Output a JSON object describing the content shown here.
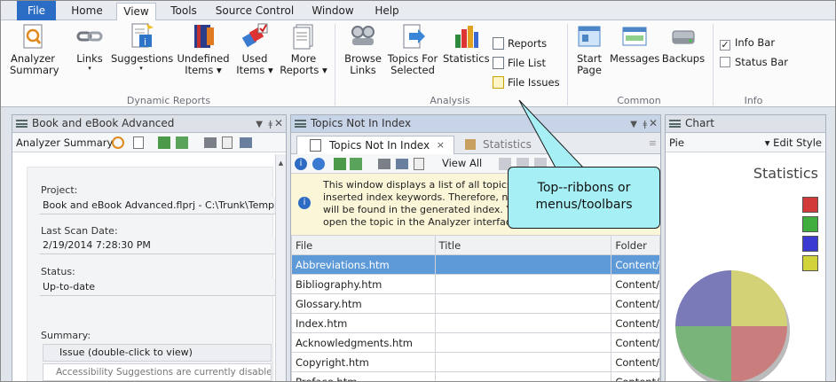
{
  "ribbon_tabs": [
    "File",
    "Home",
    "View",
    "Tools",
    "Source Control",
    "Window",
    "Help"
  ],
  "groups": {
    "dynamic_reports": {
      "label": "Dynamic Reports",
      "buttons": [
        {
          "label1": "Analyzer",
          "label2": "Summary",
          "icon": "analyzer-summary-icon"
        },
        {
          "label1": "Links",
          "label2": "▾",
          "icon": "links-icon"
        },
        {
          "label1": "Suggestions",
          "label2": "▾",
          "icon": "suggestions-icon"
        },
        {
          "label1": "Undefined",
          "label2": "Items ▾",
          "icon": "undefined-items-icon"
        },
        {
          "label1": "Used",
          "label2": "Items ▾",
          "icon": "used-items-icon"
        },
        {
          "label1": "More",
          "label2": "Reports ▾",
          "icon": "more-reports-icon"
        }
      ]
    },
    "analysis": {
      "label": "Analysis",
      "buttons": [
        {
          "label1": "Browse",
          "label2": "Links",
          "icon": "browse-links-icon"
        },
        {
          "label1": "Topics For",
          "label2": "Selected",
          "icon": "topics-for-selected-icon"
        },
        {
          "label1": "Statistics",
          "label2": "",
          "icon": "statistics-icon"
        }
      ],
      "small_buttons": [
        "Reports",
        "File List",
        "File Issues"
      ]
    },
    "common": {
      "label": "Common",
      "buttons": [
        {
          "label1": "Start",
          "label2": "Page",
          "icon": "start-page-icon"
        },
        {
          "label1": "Messages",
          "label2": "",
          "icon": "messages-icon"
        },
        {
          "label1": "Backups",
          "label2": "",
          "icon": "backups-icon"
        }
      ]
    },
    "info": {
      "label": "Info",
      "checkboxes": [
        {
          "label": "Info Bar",
          "checked": true
        },
        {
          "label": "Status Bar",
          "checked": false
        }
      ]
    }
  },
  "left_panel": {
    "title": "Book and eBook Advanced",
    "toolbar_label": "Analyzer Summary",
    "project_label": "Project:",
    "project_value": "Book and eBook Advanced.flprj - C:\\Trunk\\Templates\\",
    "last_scan_label": "Last Scan Date:",
    "last_scan_value": "2/19/2014 7:28:30 PM",
    "status_label": "Status:",
    "status_value": "Up-to-date",
    "summary_label": "Summary:",
    "summary_header": "Issue (double-click to view)",
    "summary_row": "Accessibility Suggestions are currently disabled."
  },
  "middle_panel": {
    "title": "Topics Not In Index",
    "doc_tabs": [
      "Topics Not In Index",
      "Statistics"
    ],
    "view_all": "View All",
    "info_text_lines": [
      "This window displays a list of all topics",
      "inserted index keywords. Therefore, no",
      "will be found in the generated index. Yo",
      "open the topic in the Analyzer interface"
    ],
    "columns": [
      "File",
      "Title",
      "Folder"
    ],
    "rows": [
      {
        "file": "Abbreviations.htm",
        "title": "",
        "folder": "Content/"
      },
      {
        "file": "Bibliography.htm",
        "title": "",
        "folder": "Content/"
      },
      {
        "file": "Glossary.htm",
        "title": "",
        "folder": "Content/"
      },
      {
        "file": "Index.htm",
        "title": "",
        "folder": "Content/"
      },
      {
        "file": "Acknowledgments.htm",
        "title": "",
        "folder": "Content/"
      },
      {
        "file": "Copyright.htm",
        "title": "",
        "folder": "Content/"
      },
      {
        "file": "Preface.htm",
        "title": "",
        "folder": "Content/"
      }
    ]
  },
  "right_panel": {
    "title": "Chart",
    "chart_type": "Pie",
    "edit_style": "▾  Edit Style",
    "chart_title": "Statistics",
    "legend_colors": [
      "#d23a3a",
      "#3fae3f",
      "#3a3ad2",
      "#d2d23a"
    ],
    "pie_colors": [
      "#d4d277",
      "#c97d7d",
      "#79b47a",
      "#7a7ab8"
    ]
  },
  "callout": {
    "line1": "Top--ribbons or",
    "line2": "menus/toolbars"
  }
}
